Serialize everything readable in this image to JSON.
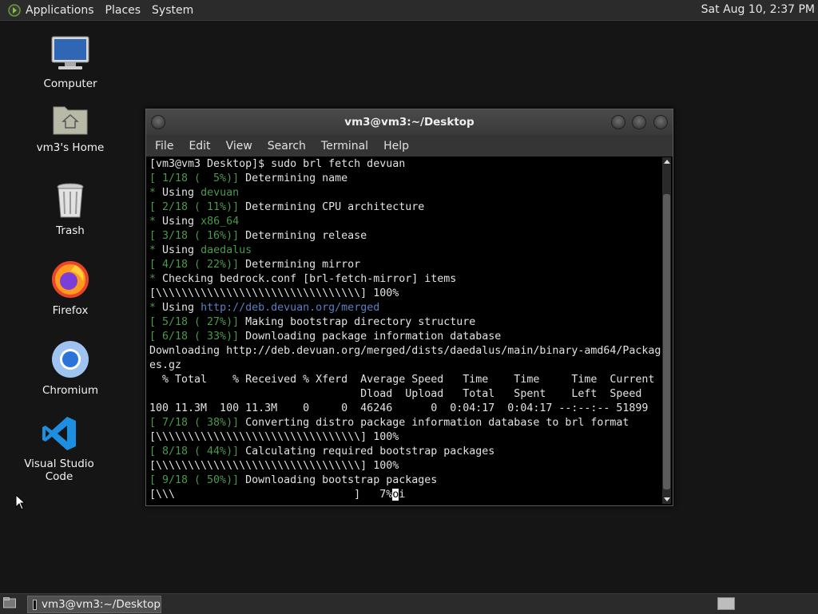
{
  "top_panel": {
    "menu": [
      "Applications",
      "Places",
      "System"
    ],
    "clock": "Sat Aug 10,  2:37 PM"
  },
  "desktop_icons": [
    {
      "label": "Computer",
      "icon": "computer-icon"
    },
    {
      "label": "vm3's Home",
      "icon": "home-folder-icon"
    },
    {
      "label": "Trash",
      "icon": "trash-icon"
    },
    {
      "label": "Firefox",
      "icon": "firefox-icon"
    },
    {
      "label": "Chromium",
      "icon": "chromium-icon"
    },
    {
      "label": "Visual Studio Code",
      "icon": "vscode-icon"
    }
  ],
  "window": {
    "title": "vm3@vm3:~/Desktop",
    "menu": [
      "File",
      "Edit",
      "View",
      "Search",
      "Terminal",
      "Help"
    ]
  },
  "terminal": {
    "lines": [
      {
        "parts": [
          {
            "t": "[vm3@vm3 Desktop]$ sudo brl fetch devuan",
            "c": ""
          }
        ]
      },
      {
        "parts": [
          {
            "t": "[ 1/18 (  5%)]",
            "c": "green"
          },
          {
            "t": " Determining name",
            "c": ""
          }
        ]
      },
      {
        "parts": [
          {
            "t": "*",
            "c": "green"
          },
          {
            "t": " Using ",
            "c": ""
          },
          {
            "t": "devuan",
            "c": "green"
          }
        ]
      },
      {
        "parts": [
          {
            "t": "[ 2/18 ( 11%)]",
            "c": "green"
          },
          {
            "t": " Determining CPU architecture",
            "c": ""
          }
        ]
      },
      {
        "parts": [
          {
            "t": "*",
            "c": "green"
          },
          {
            "t": " Using ",
            "c": ""
          },
          {
            "t": "x86_64",
            "c": "green"
          }
        ]
      },
      {
        "parts": [
          {
            "t": "[ 3/18 ( 16%)]",
            "c": "green"
          },
          {
            "t": " Determining release",
            "c": ""
          }
        ]
      },
      {
        "parts": [
          {
            "t": "*",
            "c": "green"
          },
          {
            "t": " Using ",
            "c": ""
          },
          {
            "t": "daedalus",
            "c": "green"
          }
        ]
      },
      {
        "parts": [
          {
            "t": "[ 4/18 ( 22%)]",
            "c": "green"
          },
          {
            "t": " Determining mirror",
            "c": ""
          }
        ]
      },
      {
        "parts": [
          {
            "t": "*",
            "c": "green"
          },
          {
            "t": " Checking bedrock.conf [brl-fetch-mirror] items",
            "c": ""
          }
        ]
      },
      {
        "parts": [
          {
            "t": "[\\\\\\\\\\\\\\\\\\\\\\\\\\\\\\\\\\\\\\\\\\\\\\\\\\\\\\\\\\\\\\\\] 100%",
            "c": ""
          }
        ]
      },
      {
        "parts": [
          {
            "t": "*",
            "c": "green"
          },
          {
            "t": " Using ",
            "c": ""
          },
          {
            "t": "http://deb.devuan.org/merged",
            "c": "blue"
          }
        ]
      },
      {
        "parts": [
          {
            "t": "[ 5/18 ( 27%)]",
            "c": "green"
          },
          {
            "t": " Making bootstrap directory structure",
            "c": ""
          }
        ]
      },
      {
        "parts": [
          {
            "t": "[ 6/18 ( 33%)]",
            "c": "green"
          },
          {
            "t": " Downloading package information database",
            "c": ""
          }
        ]
      },
      {
        "parts": [
          {
            "t": "Downloading http://deb.devuan.org/merged/dists/daedalus/main/binary-amd64/Packag",
            "c": ""
          }
        ]
      },
      {
        "parts": [
          {
            "t": "es.gz",
            "c": ""
          }
        ]
      },
      {
        "parts": [
          {
            "t": "  % Total    % Received % Xferd  Average Speed   Time    Time     Time  Current",
            "c": ""
          }
        ]
      },
      {
        "parts": [
          {
            "t": "                                 Dload  Upload   Total   Spent    Left  Speed",
            "c": ""
          }
        ]
      },
      {
        "parts": [
          {
            "t": "100 11.3M  100 11.3M    0     0  46246      0  0:04:17  0:04:17 --:--:-- 51899",
            "c": ""
          }
        ]
      },
      {
        "parts": [
          {
            "t": "[ 7/18 ( 38%)]",
            "c": "green"
          },
          {
            "t": " Converting distro package information database to brl format",
            "c": ""
          }
        ]
      },
      {
        "parts": [
          {
            "t": "[\\\\\\\\\\\\\\\\\\\\\\\\\\\\\\\\\\\\\\\\\\\\\\\\\\\\\\\\\\\\\\\\] 100%",
            "c": ""
          }
        ]
      },
      {
        "parts": [
          {
            "t": "[ 8/18 ( 44%)]",
            "c": "green"
          },
          {
            "t": " Calculating required bootstrap packages",
            "c": ""
          }
        ]
      },
      {
        "parts": [
          {
            "t": "[\\\\\\\\\\\\\\\\\\\\\\\\\\\\\\\\\\\\\\\\\\\\\\\\\\\\\\\\\\\\\\\\] 100%",
            "c": ""
          }
        ]
      },
      {
        "parts": [
          {
            "t": "[ 9/18 ( 50%)]",
            "c": "green"
          },
          {
            "t": " Downloading bootstrap packages",
            "c": ""
          }
        ]
      },
      {
        "parts": [
          {
            "t": "[\\\\\\                            ]   7%",
            "c": ""
          },
          {
            "t": "o",
            "c": "cursor"
          },
          {
            "t": "i",
            "c": ""
          }
        ]
      }
    ]
  },
  "taskbar": {
    "task_label": "vm3@vm3:~/Desktop"
  }
}
